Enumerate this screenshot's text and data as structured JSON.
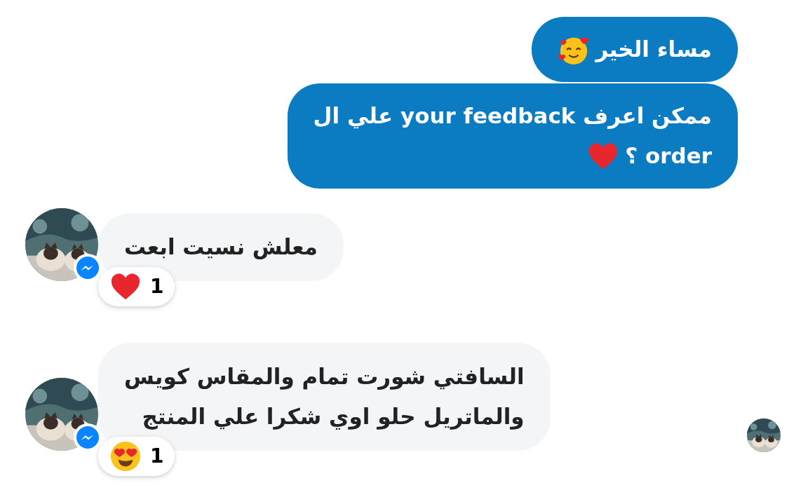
{
  "messages": [
    {
      "kind": "outgoing",
      "lines": [
        "مساء الخير"
      ],
      "emoji": {
        "kind": "smiling-hearts"
      }
    },
    {
      "kind": "outgoing",
      "lines": [
        "ممكن اعرف your feedback علي ال",
        "order ؟"
      ],
      "emoji": {
        "kind": "heart"
      }
    },
    {
      "kind": "incoming",
      "lines": [
        "معلش نسيت ابعت"
      ],
      "reaction": {
        "kind": "heart",
        "count": "1"
      }
    },
    {
      "kind": "incoming",
      "lines": [
        "السافتي شورت تمام والمقاس كويس",
        "والماتريل حلو اوي شكرا علي المنتج"
      ],
      "reaction": {
        "kind": "heart-eyes",
        "count": "1"
      }
    }
  ],
  "seen": true
}
